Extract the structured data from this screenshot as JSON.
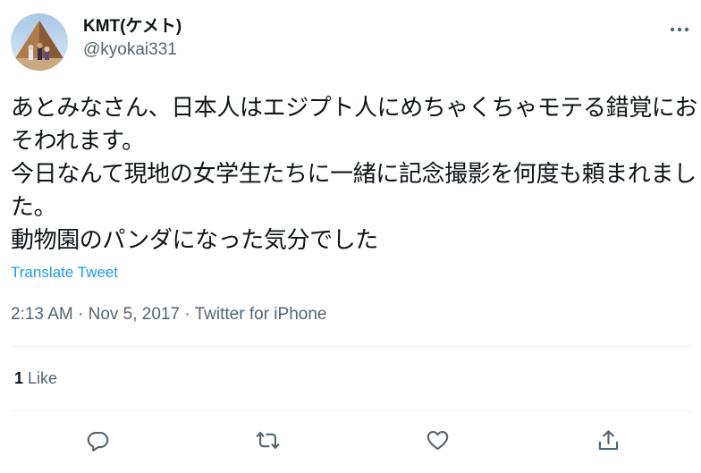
{
  "user": {
    "display_name": "KMT(ケメト)",
    "handle": "@kyokai331",
    "avatar_icon": "profile-photo-pyramid"
  },
  "more_icon": "more-horizontal-icon",
  "tweet": {
    "text": "あとみなさん、日本人はエジプト人にめちゃくちゃモテる錯覚におそわれます。\n今日なんて現地の女学生たちに一緒に記念撮影を何度も頼まれました。\n動物園のパンダになった気分でした",
    "translate_label": "Translate Tweet"
  },
  "meta": {
    "time": "2:13 AM",
    "separator1": " · ",
    "date": "Nov 5, 2017",
    "separator2": " · ",
    "source": "Twitter for iPhone"
  },
  "engagement": {
    "like_count": "1",
    "like_label": " Like"
  },
  "actions": [
    {
      "icon": "reply-icon"
    },
    {
      "icon": "retweet-icon"
    },
    {
      "icon": "like-icon"
    },
    {
      "icon": "share-icon"
    }
  ],
  "colors": {
    "link": "#1d9bf0",
    "secondary_text": "#536471",
    "primary_text": "#0f1419",
    "divider": "#eff3f4"
  }
}
